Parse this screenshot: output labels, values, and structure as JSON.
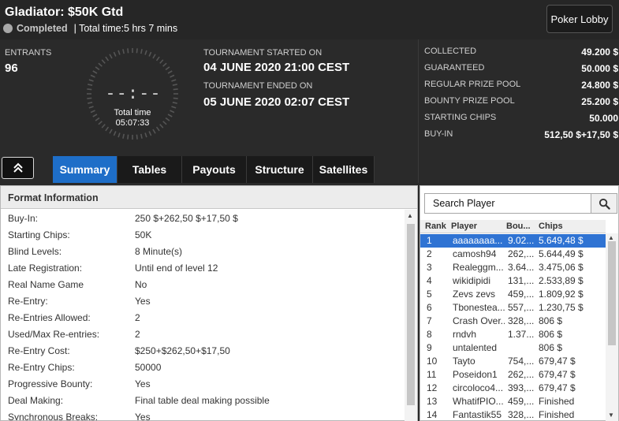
{
  "header": {
    "title": "Gladiator: $50K Gtd",
    "status": "Completed",
    "total_time": "| Total time:5 hrs  7 mins",
    "lobby_button": "Poker Lobby"
  },
  "info": {
    "entrants_label": "ENTRANTS",
    "entrants_value": "96",
    "clock_digits": "--:--",
    "clock_label": "Total time",
    "clock_value": "05:07:33",
    "started_label": "TOURNAMENT STARTED ON",
    "started_value": "04 JUNE 2020   21:00 CEST",
    "ended_label": "TOURNAMENT ENDED ON",
    "ended_value": "05 JUNE 2020   02:07 CEST"
  },
  "prize": [
    {
      "label": "COLLECTED",
      "value": "49.200 $"
    },
    {
      "label": "GUARANTEED",
      "value": "50.000 $"
    },
    {
      "label": "REGULAR PRIZE POOL",
      "value": "24.800 $"
    },
    {
      "label": "BOUNTY PRIZE POOL",
      "value": "25.200 $"
    },
    {
      "label": "STARTING CHIPS",
      "value": "50.000"
    },
    {
      "label": "BUY-IN",
      "value": "512,50 $+17,50 $"
    }
  ],
  "tabs": [
    "Summary",
    "Tables",
    "Payouts",
    "Structure",
    "Satellites"
  ],
  "format": {
    "title": "Format Information",
    "rows": [
      {
        "k": "Buy-In:",
        "v": "250 $+262,50 $+17,50 $"
      },
      {
        "k": "Starting Chips:",
        "v": "50K"
      },
      {
        "k": "Blind Levels:",
        "v": "8 Minute(s)"
      },
      {
        "k": "Late Registration:",
        "v": "Until end of level 12"
      },
      {
        "k": "Real Name Game",
        "v": "No"
      },
      {
        "k": "Re-Entry:",
        "v": "Yes"
      },
      {
        "k": "Re-Entries Allowed:",
        "v": "2"
      },
      {
        "k": "Used/Max Re-entries:",
        "v": "2"
      },
      {
        "k": "Re-Entry Cost:",
        "v": "$250+$262,50+$17,50"
      },
      {
        "k": "Re-Entry Chips:",
        "v": "50000"
      },
      {
        "k": "Progressive Bounty:",
        "v": "Yes"
      },
      {
        "k": "Deal Making:",
        "v": "Final table deal making possible"
      },
      {
        "k": "Synchronous Breaks:",
        "v": "Yes"
      }
    ]
  },
  "players": {
    "search_placeholder": "Search Player",
    "headers": [
      "Rank",
      "Player",
      "Bou...",
      "Chips"
    ],
    "rows": [
      {
        "rank": "1",
        "player": "aaaaaaaa...",
        "bounty": "9.02...",
        "chips": "5.649,48 $"
      },
      {
        "rank": "2",
        "player": "camosh94",
        "bounty": "262,...",
        "chips": "5.644,49 $"
      },
      {
        "rank": "3",
        "player": "Realeggm...",
        "bounty": "3.64...",
        "chips": "3.475,06 $"
      },
      {
        "rank": "4",
        "player": "wikidipidi",
        "bounty": "131,...",
        "chips": "2.533,89 $"
      },
      {
        "rank": "5",
        "player": "Zevs zevs",
        "bounty": "459,...",
        "chips": "1.809,92 $"
      },
      {
        "rank": "6",
        "player": "Tbonestea...",
        "bounty": "557,...",
        "chips": "1.230,75 $"
      },
      {
        "rank": "7",
        "player": "Crash Over...",
        "bounty": "328,...",
        "chips": "806 $"
      },
      {
        "rank": "8",
        "player": "rndvh",
        "bounty": "1.37...",
        "chips": "806 $"
      },
      {
        "rank": "9",
        "player": "untalented",
        "bounty": "",
        "chips": "806 $"
      },
      {
        "rank": "10",
        "player": "Tayto",
        "bounty": "754,...",
        "chips": "679,47 $"
      },
      {
        "rank": "11",
        "player": "Poseidon1",
        "bounty": "262,...",
        "chips": "679,47 $"
      },
      {
        "rank": "12",
        "player": "circoloco4...",
        "bounty": "393,...",
        "chips": "679,47 $"
      },
      {
        "rank": "13",
        "player": "WhatifPIO...",
        "bounty": "459,...",
        "chips": "Finished"
      },
      {
        "rank": "14",
        "player": "Fantastik55",
        "bounty": "328,...",
        "chips": "Finished"
      }
    ]
  },
  "colors": {
    "accent": "#1e6ec8",
    "selected_row": "#2f73d3"
  },
  "icons": {
    "collapse": "double-chevron-up-icon",
    "search": "search-icon",
    "status": "status-dot-icon"
  }
}
